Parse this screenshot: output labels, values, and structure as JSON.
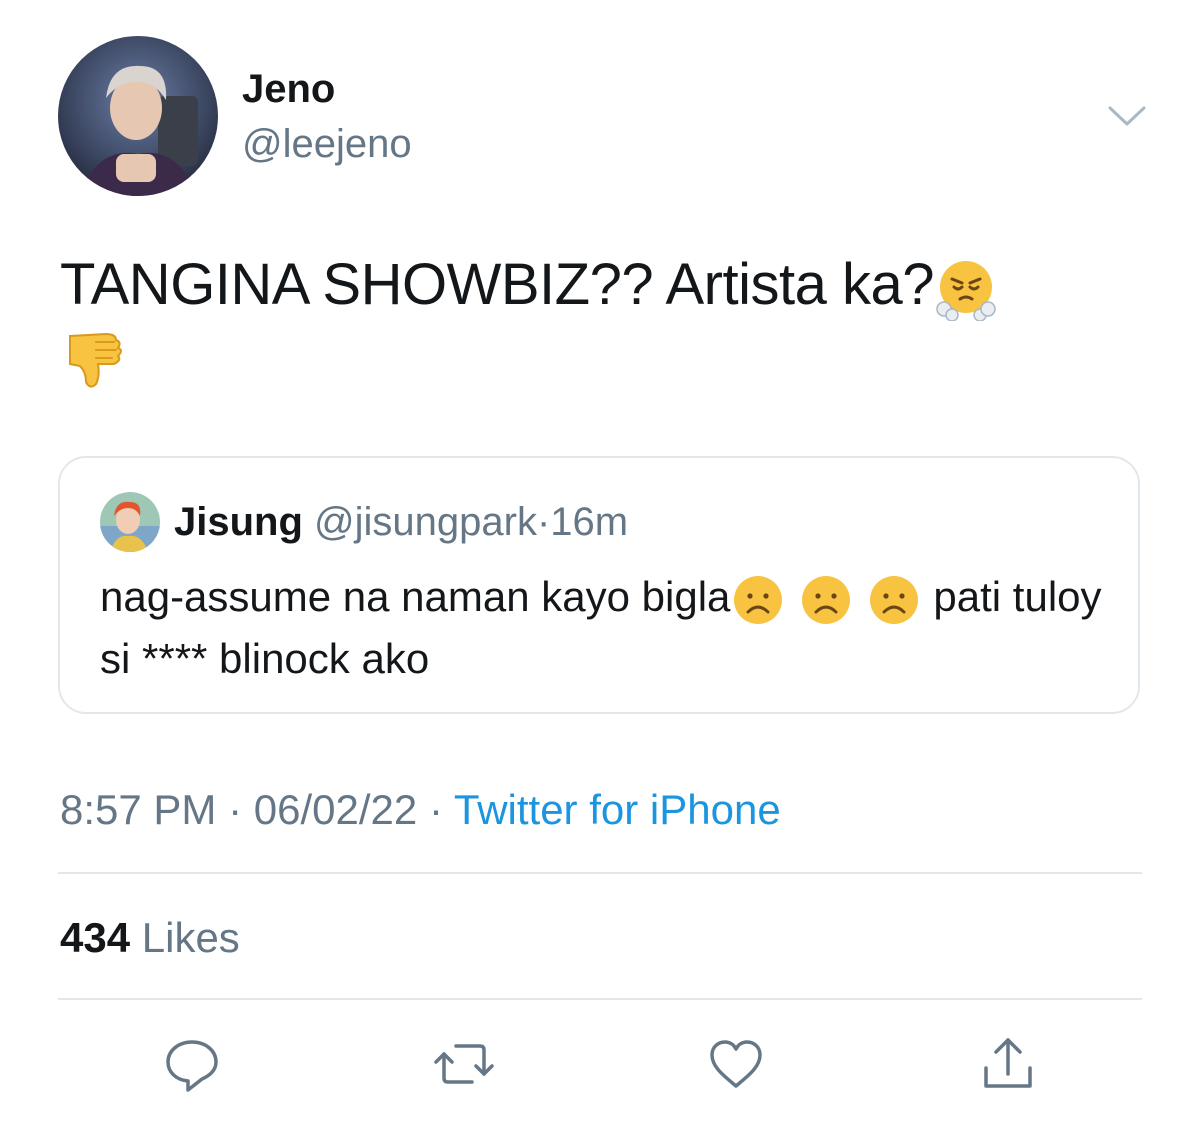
{
  "author": {
    "display_name": "Jeno",
    "handle": "@leejeno"
  },
  "tweet": {
    "text": "TANGINA SHOWBIZ?? Artista ka?",
    "emojis": [
      "face-with-steam-from-nose",
      "thumbs-down"
    ]
  },
  "quoted_tweet": {
    "display_name": "Jisung",
    "handle": "@jisungpark",
    "separator": "·",
    "time": "16m",
    "text_part1": "nag-assume na naman kayo bigla",
    "emojis": [
      "frowning-face",
      "frowning-face",
      "frowning-face"
    ],
    "text_part2": " pati tuloy si **** blinock ako"
  },
  "meta": {
    "time": "8:57 PM",
    "separator": "·",
    "date": "06/02/22",
    "source": "Twitter for iPhone"
  },
  "stats": {
    "likes_count": "434",
    "likes_label": "Likes"
  },
  "actions": [
    "reply-icon",
    "retweet-icon",
    "like-icon",
    "share-icon"
  ],
  "colors": {
    "text": "#14171a",
    "secondary": "#657786",
    "link": "#1b95e0",
    "border": "#e1e8ed",
    "icon": "#657786"
  }
}
